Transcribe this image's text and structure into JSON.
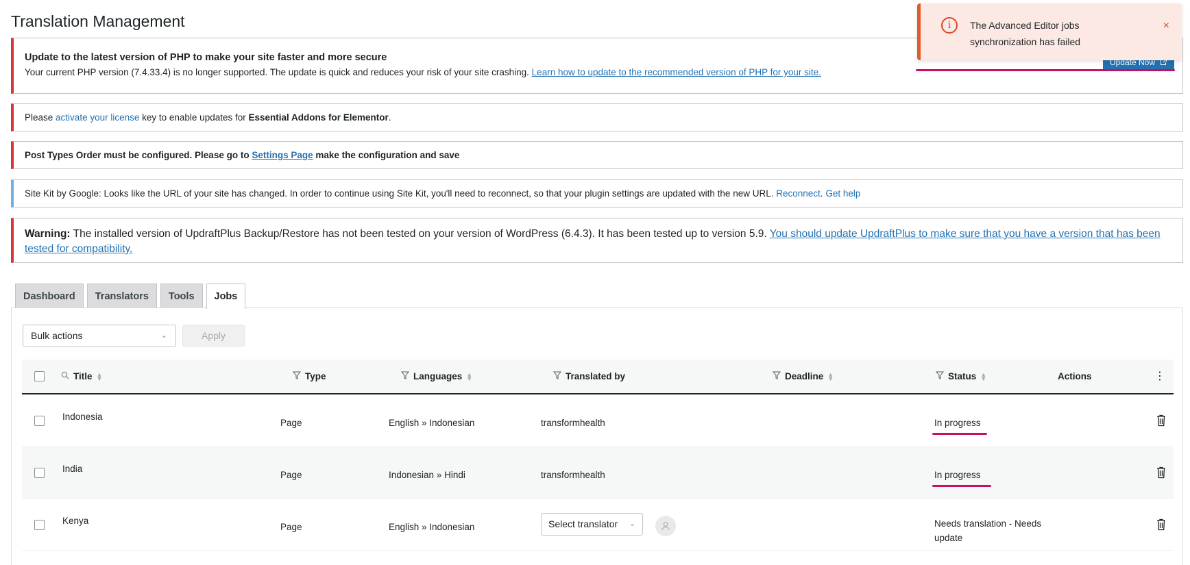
{
  "page": {
    "title": "Translation Management"
  },
  "toast": {
    "message": "The Advanced Editor jobs synchronization has failed",
    "close": "×",
    "icon": "info-icon",
    "accent": "#e05a2b"
  },
  "notices": {
    "php": {
      "title": "Update to the latest version of PHP to make your site faster and more secure",
      "body": "Your current PHP version (7.4.33.4) is no longer supported. The update is quick and reduces your risk of your site crashing.",
      "link": "Learn how to update to the recommended version of PHP for your site.",
      "button": "Update Now"
    },
    "license": {
      "pre": "Please",
      "link": "activate your license",
      "mid": "key to enable updates for",
      "plugin": "Essential Addons for Elementor",
      "post": "."
    },
    "pto": {
      "pre": "Post Types Order must be configured. Please go to",
      "link": "Settings Page",
      "post": "make the configuration and save"
    },
    "sitekit": {
      "text": "Site Kit by Google: Looks like the URL of your site has changed. In order to continue using Site Kit, you'll need to reconnect, so that your plugin settings are updated with the new URL.",
      "link1": "Reconnect",
      "sep": ".",
      "link2": "Get help"
    },
    "updraft": {
      "label": "Warning:",
      "text": "The installed version of UpdraftPlus Backup/Restore has not been tested on your version of WordPress (6.4.3). It has been tested up to version 5.9.",
      "link": "You should update UpdraftPlus to make sure that you have a version that has been tested for compatibility."
    }
  },
  "tabs": [
    {
      "label": "Dashboard",
      "active": false
    },
    {
      "label": "Translators",
      "active": false
    },
    {
      "label": "Tools",
      "active": false
    },
    {
      "label": "Jobs",
      "active": true
    }
  ],
  "toolbar": {
    "bulk_actions": "Bulk actions",
    "apply": "Apply"
  },
  "table": {
    "columns": {
      "title": "Title",
      "type": "Type",
      "languages": "Languages",
      "translated_by": "Translated by",
      "deadline": "Deadline",
      "status": "Status",
      "actions": "Actions"
    },
    "rows": [
      {
        "title": "Indonesia",
        "type": "Page",
        "languages": "English » Indonesian",
        "translated_by": "transformhealth",
        "status": "In progress"
      },
      {
        "title": "India",
        "type": "Page",
        "languages": "Indonesian » Hindi",
        "translated_by": "transformhealth",
        "status": "In progress"
      },
      {
        "title": "Kenya",
        "type": "Page",
        "languages": "English » Indonesian",
        "translator_select": "Select translator",
        "status": "Needs translation - Needs update"
      }
    ]
  },
  "colors": {
    "error": "#d63638",
    "info": "#72aee6",
    "link": "#2271b1",
    "annotation": "#c8105e"
  }
}
